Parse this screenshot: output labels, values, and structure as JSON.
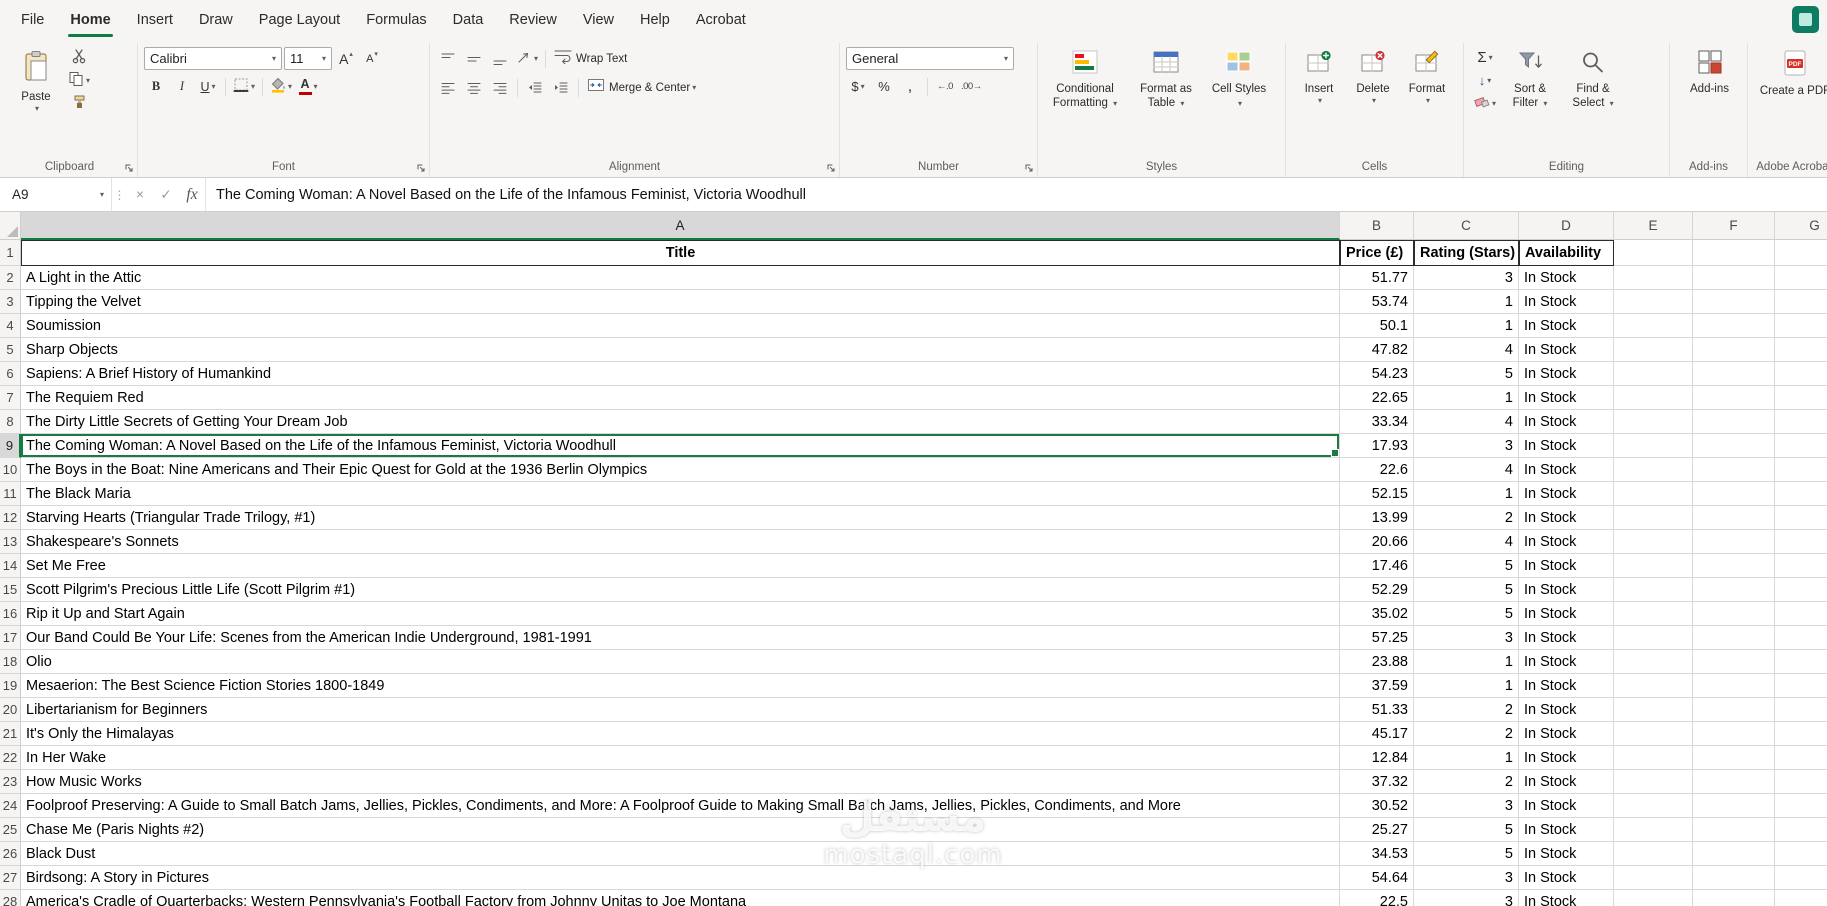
{
  "app": {
    "watermark_line1": "مستقل",
    "watermark_line2": "mostaql.com"
  },
  "colors": {
    "accent_green": "#107C41",
    "selection_border": "#1A7A46"
  },
  "menubar": {
    "tabs": [
      "File",
      "Home",
      "Insert",
      "Draw",
      "Page Layout",
      "Formulas",
      "Data",
      "Review",
      "View",
      "Help",
      "Acrobat"
    ],
    "active_tab": "Home"
  },
  "ribbon": {
    "clipboard": {
      "label": "Clipboard",
      "paste": "Paste"
    },
    "font": {
      "label": "Font",
      "family": "Calibri",
      "size": "11"
    },
    "alignment": {
      "label": "Alignment",
      "wrap_text": "Wrap Text",
      "merge_center": "Merge & Center"
    },
    "number": {
      "label": "Number",
      "format": "General"
    },
    "styles": {
      "label": "Styles",
      "conditional_formatting": "Conditional Formatting",
      "format_as_table": "Format as Table",
      "cell_styles": "Cell Styles"
    },
    "cells": {
      "label": "Cells",
      "insert": "Insert",
      "delete": "Delete",
      "format": "Format"
    },
    "editing": {
      "label": "Editing",
      "sort_filter": "Sort & Filter",
      "find_select": "Find & Select"
    },
    "addins": {
      "label": "Add-ins",
      "button": "Add-ins"
    },
    "acrobat": {
      "label": "Adobe Acrobat",
      "button": "Create a PDF"
    }
  },
  "formula_bar": {
    "name_box": "A9",
    "fx": "fx",
    "value": "The Coming Woman: A Novel Based on the Life of the Infamous Feminist, Victoria Woodhull"
  },
  "grid": {
    "columns": [
      "A",
      "B",
      "C",
      "D",
      "E",
      "F",
      "G"
    ],
    "header_row": {
      "title": "Title",
      "price": "Price (£)",
      "rating": "Rating (Stars)",
      "availability": "Availability"
    },
    "selected": {
      "cell": "A9",
      "row": 9,
      "column": "A"
    },
    "rows": [
      {
        "n": 2,
        "title": "A Light in the Attic",
        "price": "51.77",
        "rating": "3",
        "availability": "In Stock"
      },
      {
        "n": 3,
        "title": "Tipping the Velvet",
        "price": "53.74",
        "rating": "1",
        "availability": "In Stock"
      },
      {
        "n": 4,
        "title": "Soumission",
        "price": "50.1",
        "rating": "1",
        "availability": "In Stock"
      },
      {
        "n": 5,
        "title": "Sharp Objects",
        "price": "47.82",
        "rating": "4",
        "availability": "In Stock"
      },
      {
        "n": 6,
        "title": "Sapiens: A Brief History of Humankind",
        "price": "54.23",
        "rating": "5",
        "availability": "In Stock"
      },
      {
        "n": 7,
        "title": "The Requiem Red",
        "price": "22.65",
        "rating": "1",
        "availability": "In Stock"
      },
      {
        "n": 8,
        "title": "The Dirty Little Secrets of Getting Your Dream Job",
        "price": "33.34",
        "rating": "4",
        "availability": "In Stock"
      },
      {
        "n": 9,
        "title": "The Coming Woman: A Novel Based on the Life of the Infamous Feminist, Victoria Woodhull",
        "price": "17.93",
        "rating": "3",
        "availability": "In Stock"
      },
      {
        "n": 10,
        "title": "The Boys in the Boat: Nine Americans and Their Epic Quest for Gold at the 1936 Berlin Olympics",
        "price": "22.6",
        "rating": "4",
        "availability": "In Stock"
      },
      {
        "n": 11,
        "title": "The Black Maria",
        "price": "52.15",
        "rating": "1",
        "availability": "In Stock"
      },
      {
        "n": 12,
        "title": "Starving Hearts (Triangular Trade Trilogy, #1)",
        "price": "13.99",
        "rating": "2",
        "availability": "In Stock"
      },
      {
        "n": 13,
        "title": "Shakespeare's Sonnets",
        "price": "20.66",
        "rating": "4",
        "availability": "In Stock"
      },
      {
        "n": 14,
        "title": "Set Me Free",
        "price": "17.46",
        "rating": "5",
        "availability": "In Stock"
      },
      {
        "n": 15,
        "title": "Scott Pilgrim's Precious Little Life (Scott Pilgrim #1)",
        "price": "52.29",
        "rating": "5",
        "availability": "In Stock"
      },
      {
        "n": 16,
        "title": "Rip it Up and Start Again",
        "price": "35.02",
        "rating": "5",
        "availability": "In Stock"
      },
      {
        "n": 17,
        "title": "Our Band Could Be Your Life: Scenes from the American Indie Underground, 1981-1991",
        "price": "57.25",
        "rating": "3",
        "availability": "In Stock"
      },
      {
        "n": 18,
        "title": "Olio",
        "price": "23.88",
        "rating": "1",
        "availability": "In Stock"
      },
      {
        "n": 19,
        "title": "Mesaerion: The Best Science Fiction Stories 1800-1849",
        "price": "37.59",
        "rating": "1",
        "availability": "In Stock"
      },
      {
        "n": 20,
        "title": "Libertarianism for Beginners",
        "price": "51.33",
        "rating": "2",
        "availability": "In Stock"
      },
      {
        "n": 21,
        "title": "It's Only the Himalayas",
        "price": "45.17",
        "rating": "2",
        "availability": "In Stock"
      },
      {
        "n": 22,
        "title": "In Her Wake",
        "price": "12.84",
        "rating": "1",
        "availability": "In Stock"
      },
      {
        "n": 23,
        "title": "How Music Works",
        "price": "37.32",
        "rating": "2",
        "availability": "In Stock"
      },
      {
        "n": 24,
        "title": "Foolproof Preserving: A Guide to Small Batch Jams, Jellies, Pickles, Condiments, and More: A Foolproof Guide to Making Small Batch Jams, Jellies, Pickles, Condiments, and More",
        "price": "30.52",
        "rating": "3",
        "availability": "In Stock"
      },
      {
        "n": 25,
        "title": "Chase Me (Paris Nights #2)",
        "price": "25.27",
        "rating": "5",
        "availability": "In Stock"
      },
      {
        "n": 26,
        "title": "Black Dust",
        "price": "34.53",
        "rating": "5",
        "availability": "In Stock"
      },
      {
        "n": 27,
        "title": "Birdsong: A Story in Pictures",
        "price": "54.64",
        "rating": "3",
        "availability": "In Stock"
      },
      {
        "n": 28,
        "title": "America's Cradle of Quarterbacks: Western Pennsylvania's Football Factory from Johnny Unitas to Joe Montana",
        "price": "22.5",
        "rating": "3",
        "availability": "In Stock"
      }
    ]
  }
}
